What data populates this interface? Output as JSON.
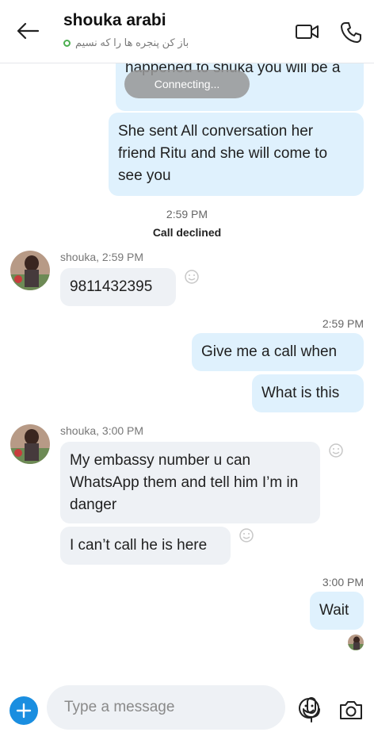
{
  "header": {
    "title": "shouka arabi",
    "status": "باز کن پنجره ها را که نسیم"
  },
  "toast": "Connecting...",
  "messages": {
    "m1": "happened to shuka you will be a",
    "m2": "She sent All conversation her friend Ritu and she will come to see you",
    "event_time": "2:59 PM",
    "event_text": "Call declined",
    "sender1": "shouka, 2:59 PM",
    "m3": "9811432395",
    "time2": "2:59 PM",
    "m4": "Give me a call when",
    "m5": "What is this",
    "sender2": "shouka, 3:00 PM",
    "m6": "My embassy number u can WhatsApp them and tell him I’m in danger",
    "m7": "I can’t call he is here",
    "time3": "3:00 PM",
    "m8": "Wait"
  },
  "composer": {
    "placeholder": "Type a message"
  },
  "icons": {
    "back": "arrow-left-icon",
    "video": "video-camera-icon",
    "call": "phone-icon",
    "add": "plus-icon",
    "emoji": "smiley-icon",
    "mic": "microphone-icon",
    "camera": "camera-icon"
  },
  "colors": {
    "accent": "#1a8ee0",
    "outgoing_bubble": "#dff1fd",
    "incoming_bubble": "#eef1f5",
    "online": "#4caf50"
  }
}
